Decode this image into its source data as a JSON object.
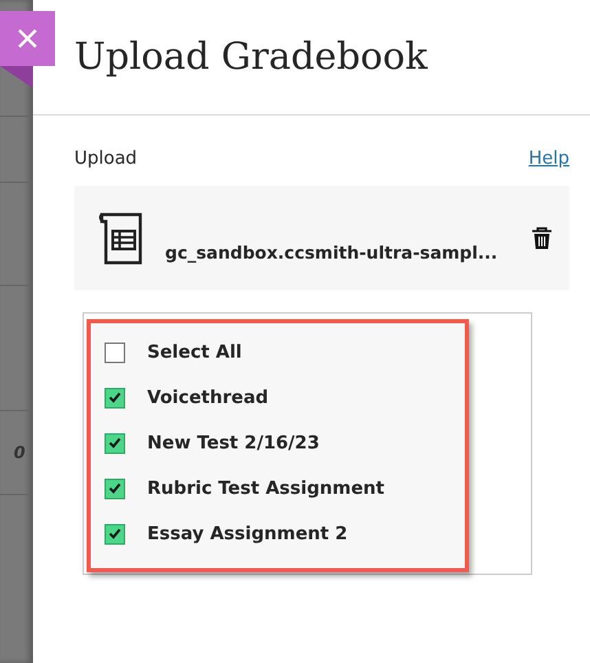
{
  "background": {
    "fragments": [
      "0"
    ]
  },
  "panel": {
    "title": "Upload Gradebook",
    "upload_label": "Upload",
    "help_link": "Help",
    "file": {
      "name": "gc_sandbox.ccsmith-ultra-sampl..."
    },
    "items": [
      {
        "label": "Select All",
        "checked": false
      },
      {
        "label": "Voicethread",
        "checked": true
      },
      {
        "label": "New Test 2/16/23",
        "checked": true
      },
      {
        "label": "Rubric Test Assignment",
        "checked": true
      },
      {
        "label": "Essay Assignment 2",
        "checked": true
      }
    ]
  }
}
